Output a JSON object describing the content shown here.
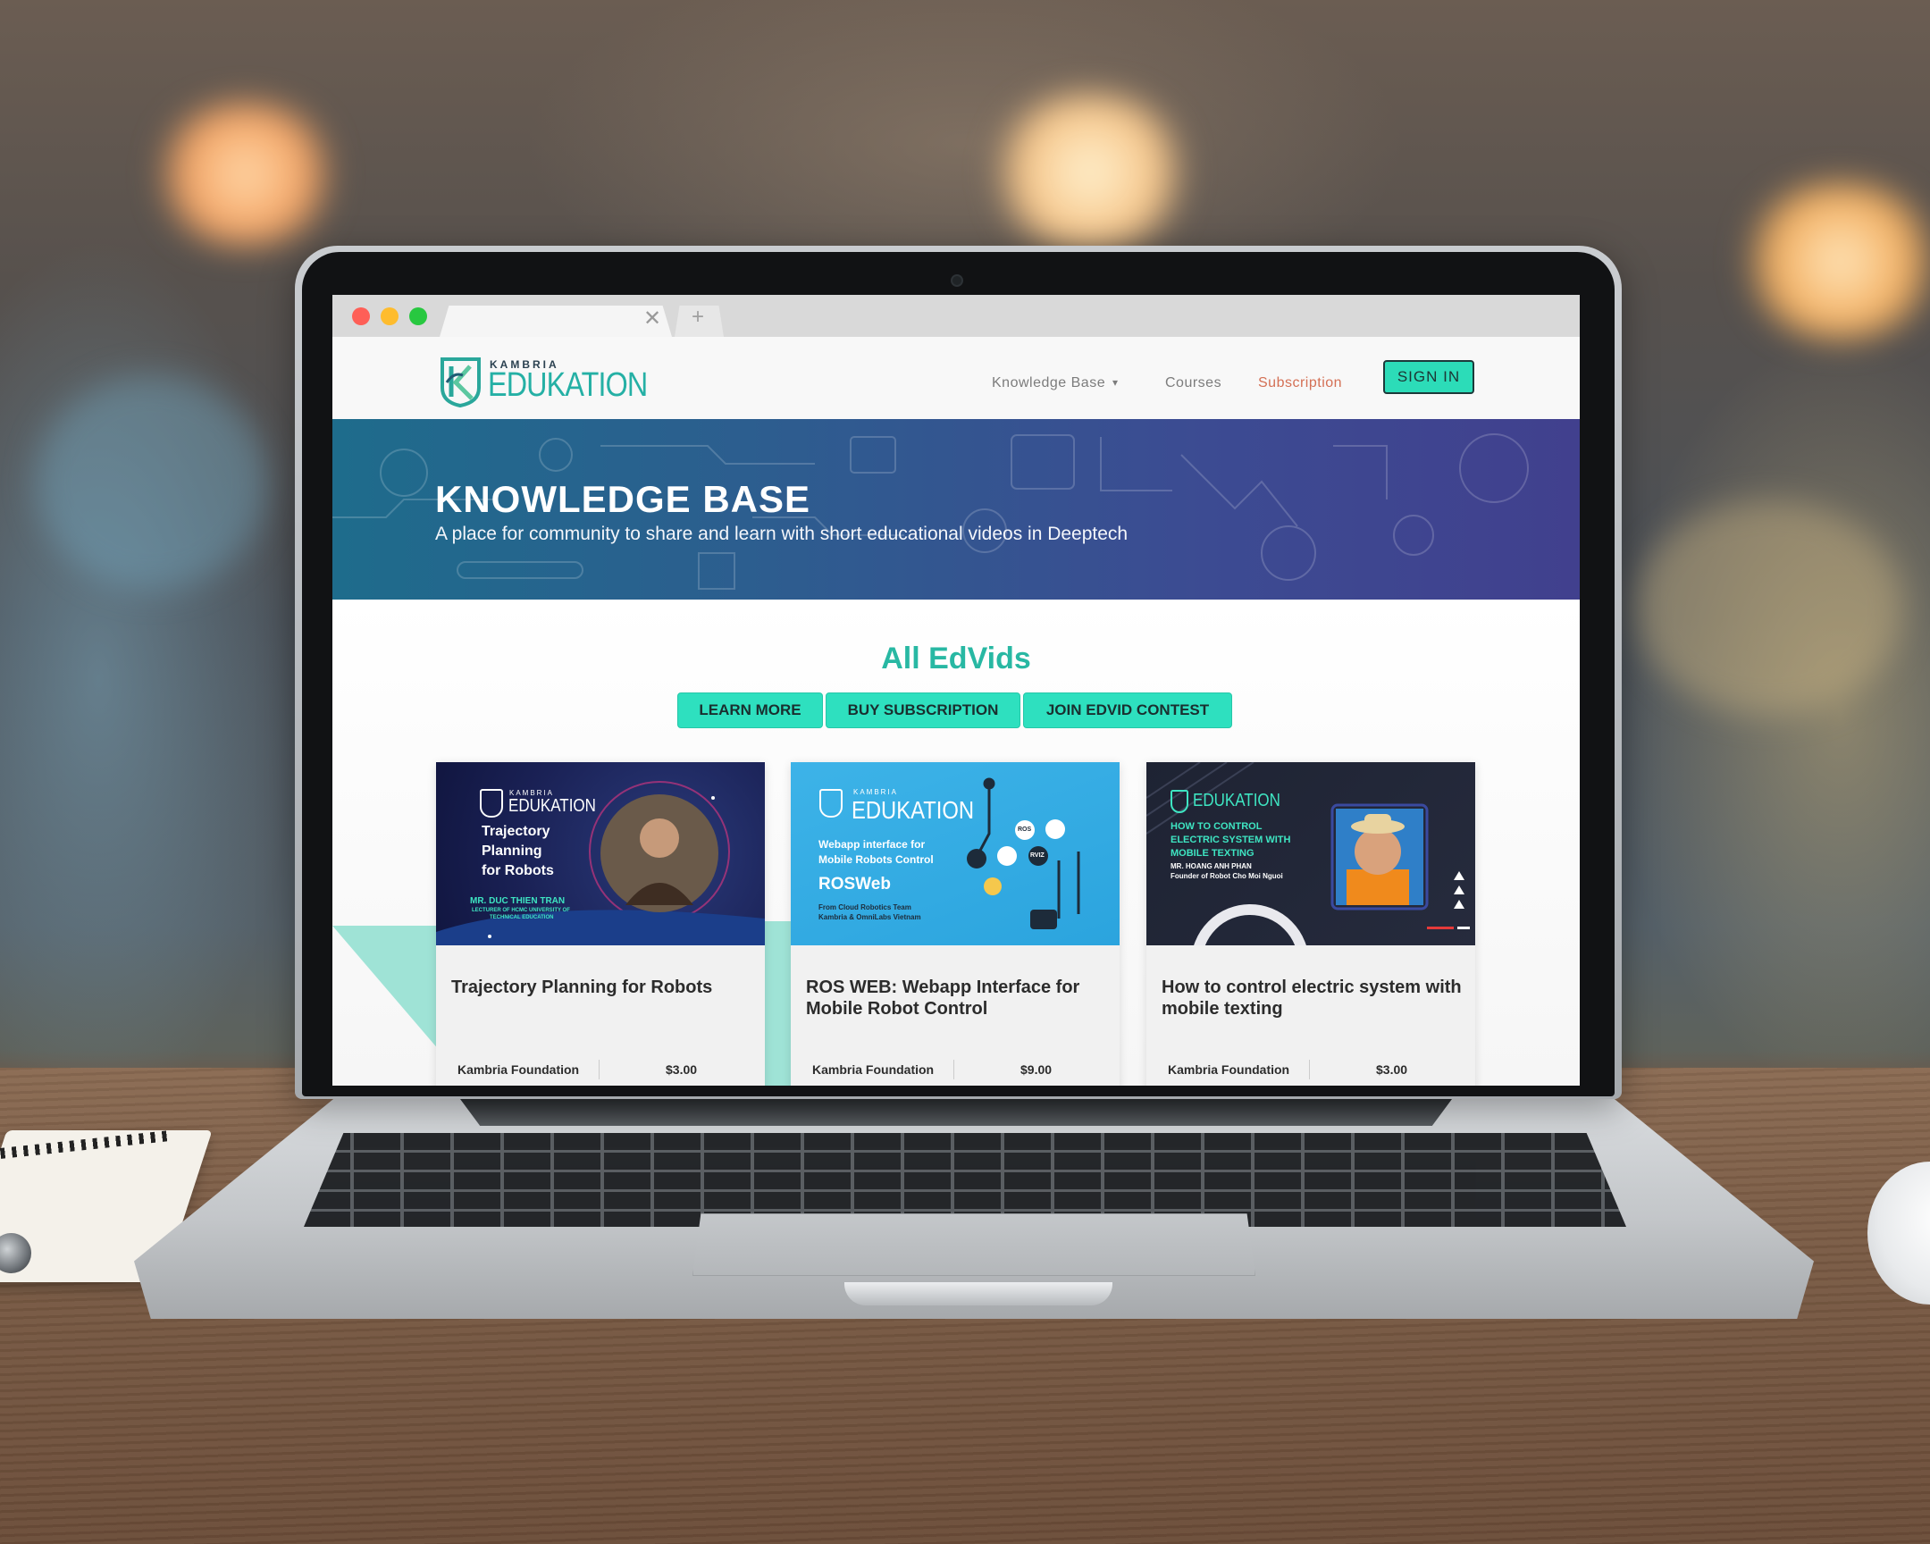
{
  "browser": {
    "tab_close": "✕",
    "new_tab": "+"
  },
  "site": {
    "logo_small": "KAMBRIA",
    "logo_big": "EDUKATION"
  },
  "nav": {
    "knowledge_base": "Knowledge Base",
    "caret": "▾",
    "courses": "Courses",
    "subscription": "Subscription",
    "sign_in": "SIGN IN"
  },
  "hero": {
    "title": "KNOWLEDGE BASE",
    "subtitle": "A place for community to share and learn with short educational videos in Deeptech"
  },
  "section": {
    "title": "All EdVids",
    "buttons": [
      "LEARN MORE",
      "BUY SUBSCRIPTION",
      "JOIN EDVID CONTEST"
    ]
  },
  "cards": [
    {
      "title": "Trajectory Planning for Robots",
      "author": "Kambria Foundation",
      "price": "$3.00",
      "thumb": {
        "brand_small": "KAMBRIA",
        "brand": "EDUKATION",
        "line1": "Trajectory",
        "line2": "Planning",
        "line3": "for Robots",
        "presenter": "MR. DUC THIEN TRAN",
        "affiliation1": "LECTURER OF HCMC UNIVERSITY OF",
        "affiliation2": "TECHNICAL EDUCATION"
      }
    },
    {
      "title": "ROS WEB: Webapp Interface for Mobile Robot Control",
      "author": "Kambria Foundation",
      "price": "$9.00",
      "thumb": {
        "brand_small": "KAMBRIA",
        "brand": "EDUKATION",
        "line1": "Webapp interface for",
        "line2": "Mobile Robots Control",
        "product": "ROSWeb",
        "credit1": "From Cloud Robotics Team",
        "credit2": "Kambria & OmniLabs Vietnam",
        "badges": [
          "ROS",
          "RVIZ"
        ]
      }
    },
    {
      "title": "How to control electric system with mobile texting",
      "author": "Kambria Foundation",
      "price": "$3.00",
      "thumb": {
        "brand": "EDUKATION",
        "line1": "HOW TO CONTROL",
        "line2": "ELECTRIC SYSTEM WITH",
        "line3": "MOBILE TEXTING",
        "presenter": "MR. HOANG ANH PHAN",
        "role": "Founder of Robot Cho Moi Nguoi"
      }
    }
  ],
  "colors": {
    "brand_teal": "#25b0a5",
    "button_mint": "#2ee0bf",
    "subscription_link": "#d47055",
    "hero_start": "#1e6c8c",
    "hero_end": "#41408e"
  }
}
